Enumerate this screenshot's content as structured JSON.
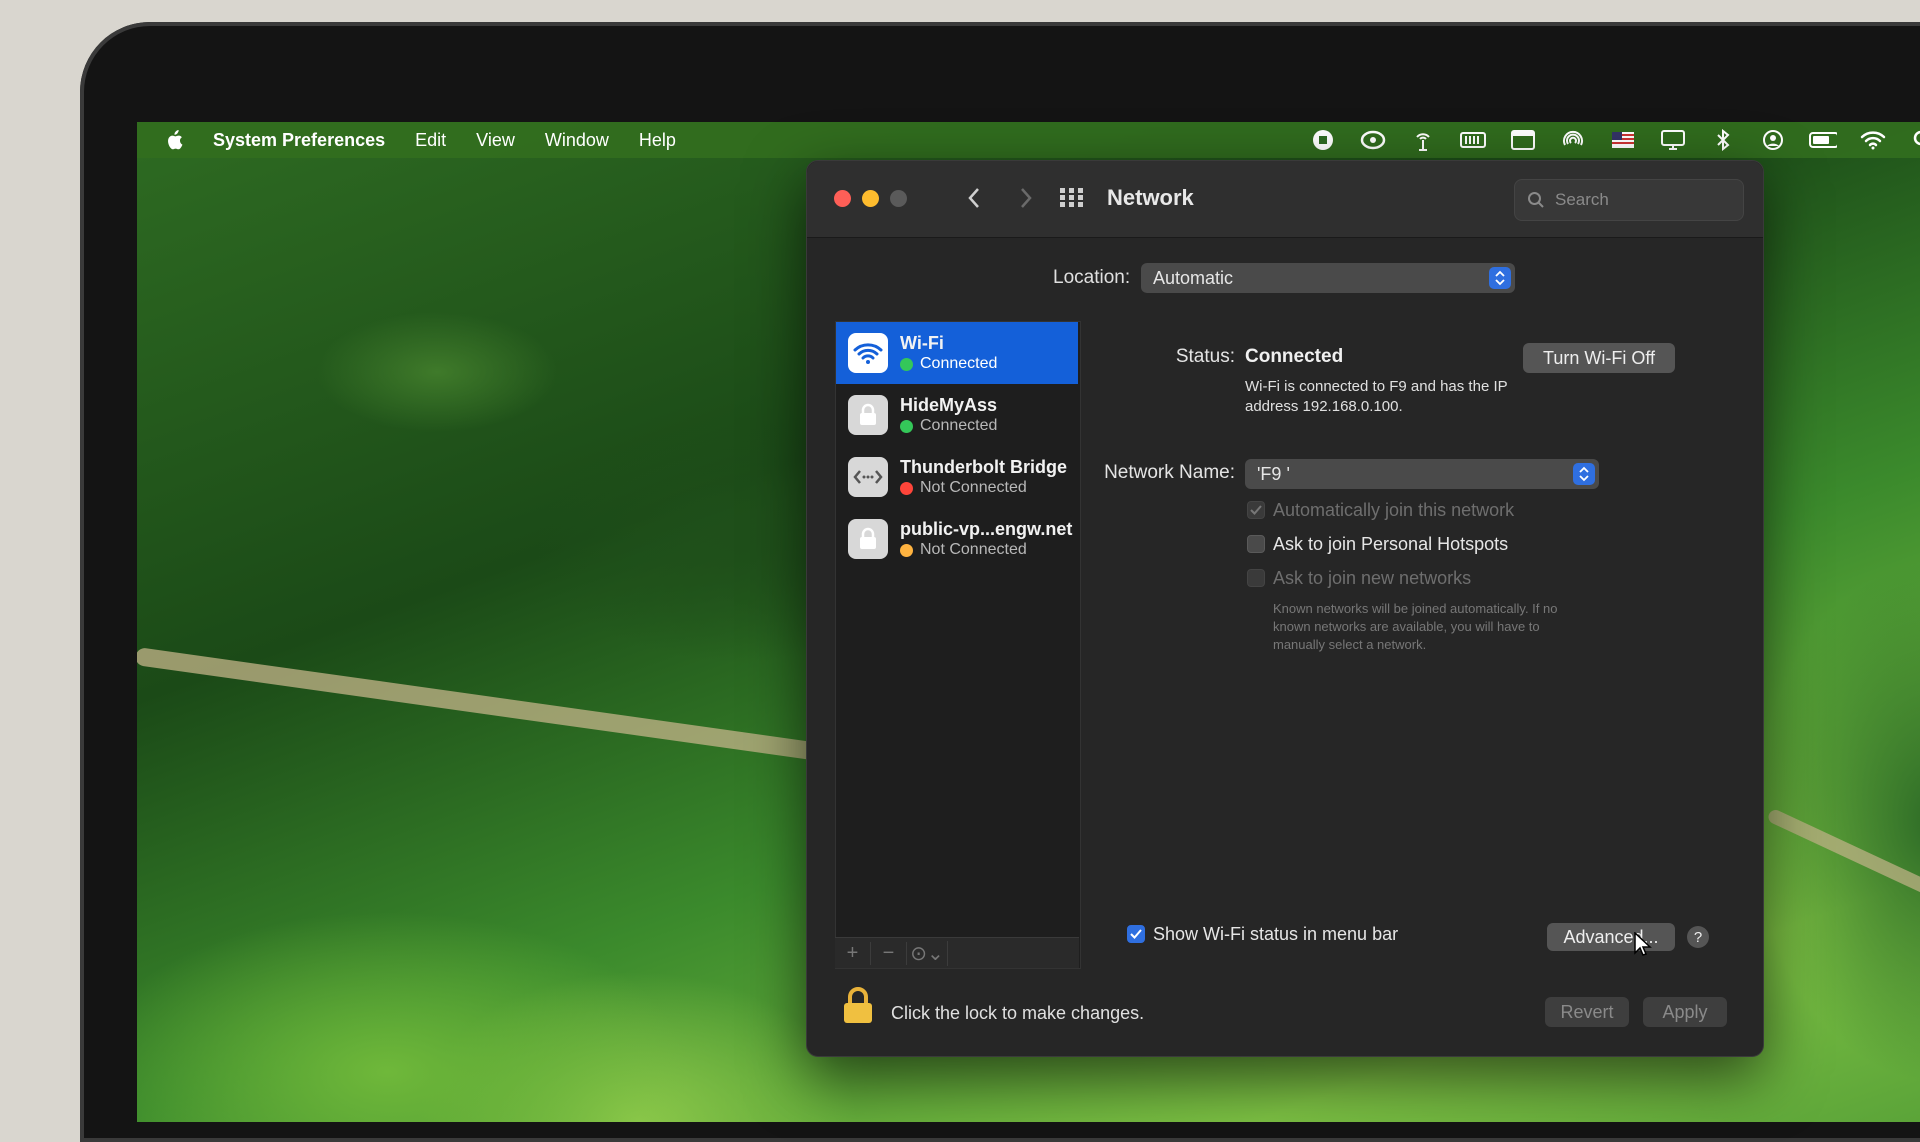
{
  "menubar": {
    "app_name": "System Preferences",
    "items": [
      "Edit",
      "View",
      "Window",
      "Help"
    ],
    "status_icons": [
      "record-icon",
      "creative-cloud-icon",
      "wifi-antenna-icon",
      "battery-meter-icon",
      "window-icon",
      "airdrop-icon",
      "flag-icon",
      "display-icon",
      "bluetooth-icon",
      "user-icon",
      "battery-icon",
      "wifi-icon",
      "spotlight-icon"
    ]
  },
  "window": {
    "title": "Network",
    "search_placeholder": "Search"
  },
  "location": {
    "label": "Location:",
    "value": "Automatic"
  },
  "services": [
    {
      "name": "Wi-Fi",
      "status": "Connected",
      "status_color": "#34c759",
      "icon": "wifi-icon",
      "selected": true
    },
    {
      "name": "HideMyAss",
      "status": "Connected",
      "status_color": "#34c759",
      "icon": "lock-icon",
      "selected": false
    },
    {
      "name": "Thunderbolt Bridge",
      "status": "Not Connected",
      "status_color": "#ff453a",
      "icon": "bridge-icon",
      "selected": false
    },
    {
      "name": "public-vp...engw.net",
      "status": "Not Connected",
      "status_color": "#ffb340",
      "icon": "lock-icon",
      "selected": false
    }
  ],
  "sidebar_controls": [
    "+",
    "−",
    "⊙⌄"
  ],
  "detail": {
    "status_label": "Status:",
    "status_value": "Connected",
    "turn_off_button": "Turn Wi-Fi Off",
    "status_desc_line1": "Wi-Fi is connected to F9  and has the IP",
    "status_desc_line2": "address 192.168.0.100.",
    "network_name_label": "Network Name:",
    "network_name_value": "'F9 '",
    "auto_join": "Automatically join this network",
    "ask_hotspots": "Ask to join Personal Hotspots",
    "ask_new": "Ask to join new networks",
    "note_line1": "Known networks will be joined automatically. If no",
    "note_line2": "known networks are available, you will have to",
    "note_line3": "manually select a network.",
    "show_status": "Show Wi-Fi status in menu bar",
    "advanced_button": "Advanced...",
    "help_button": "?"
  },
  "footer": {
    "lock_text": "Click the lock to make changes.",
    "revert": "Revert",
    "apply": "Apply"
  },
  "colors": {
    "accent": "#1460d9",
    "close": "#fe5f57",
    "minimize": "#febc2e"
  }
}
